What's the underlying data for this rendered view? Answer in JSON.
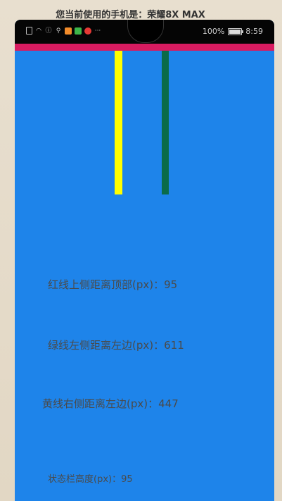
{
  "caption": "您当前使用的手机是：荣耀8X MAX",
  "status_bar": {
    "battery": "100%",
    "battery_level": 1.0,
    "time": "8:59",
    "more": "···"
  },
  "colors": {
    "background": "#1e84ea",
    "red_line": "#d81b60",
    "green_line": "#0a6b4a",
    "yellow_line": "#ffff00"
  },
  "labels": {
    "red_top": "红线上侧距离顶部(px)：95",
    "green_left": "绿线左侧距离左边(px)：611",
    "yellow_right": "黄线右侧距离左边(px)：447",
    "status_bar_height": "状态栏高度(px)：95"
  }
}
